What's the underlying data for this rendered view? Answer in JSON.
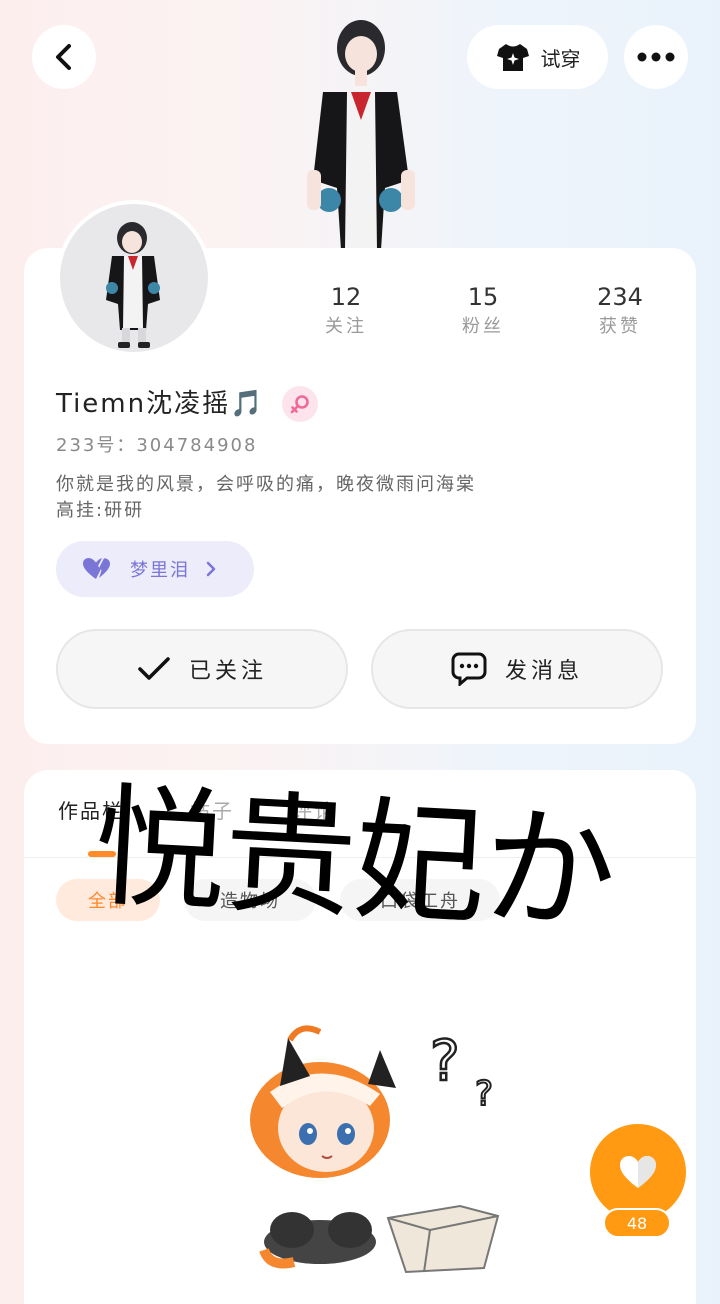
{
  "header": {
    "try_on_label": "试穿",
    "back_icon": "chevron-left-icon",
    "more_icon": "more-dots-icon",
    "try_on_icon": "shirt-sparkle-icon"
  },
  "profile": {
    "username": "Tiemn沈凌摇🎵",
    "uid_text": "233号：304784908",
    "bio_lines": [
      "你就是我的风景，会呼吸的痛，晚夜微雨问海棠",
      "高挂:研研"
    ],
    "gender": "female",
    "stats": [
      {
        "value": "12",
        "label": "关注"
      },
      {
        "value": "15",
        "label": "粉丝"
      },
      {
        "value": "234",
        "label": "获赞"
      }
    ],
    "dream_chip": "梦里泪",
    "follow_label": "已关注",
    "message_label": "发消息"
  },
  "tabs": {
    "items": [
      "作品栏",
      "帖子",
      "评论"
    ],
    "active": 0
  },
  "filters": {
    "items": [
      "全部",
      "造物场",
      "口袋工舟"
    ],
    "active": 0
  },
  "overlay_text": "悦贵妃か",
  "like": {
    "count": "48",
    "icon": "heart-icon"
  },
  "colors": {
    "accent": "#ff8a2a",
    "fab": "#ff9a12",
    "chip_purple": "#7b76d6",
    "gender_pink": "#f06a96"
  }
}
